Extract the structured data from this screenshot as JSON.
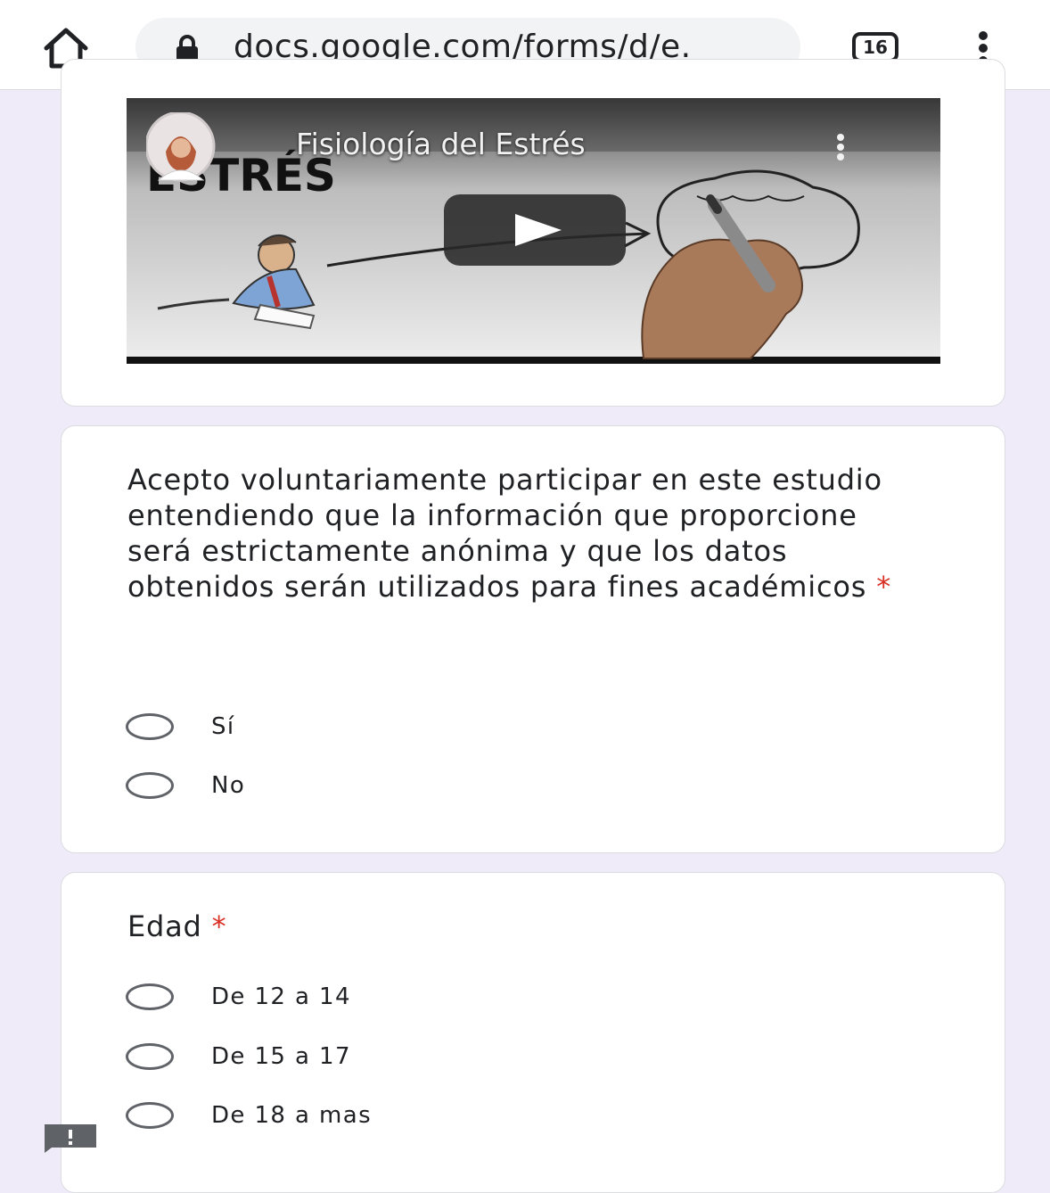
{
  "browser": {
    "url": "docs.google.com/forms/d/e.",
    "tab_count": "16",
    "icons": [
      "home-icon",
      "lock-icon",
      "tab-switcher-icon",
      "more-vert-icon"
    ]
  },
  "video": {
    "title": "Fisiología del Estrés",
    "thumbnail_caption": "ESTRÉS",
    "icons": [
      "channel-avatar",
      "play-icon",
      "more-vert-icon"
    ]
  },
  "consent_question": {
    "title": "Acepto voluntariamente participar en este estudio entendiendo que la información que proporcione será estrictamente anónima y que los datos obtenidos serán utilizados para fines académicos",
    "required_mark": "*",
    "options": [
      "Sí",
      "No"
    ]
  },
  "age_question": {
    "title": "Edad",
    "required_mark": "*",
    "options": [
      "De 12 a 14",
      "De 15 a 17",
      "De 18 a mas"
    ]
  },
  "colors": {
    "page_background": "#f0ebf8",
    "required": "#d93025",
    "radio_border": "#5f6368"
  }
}
